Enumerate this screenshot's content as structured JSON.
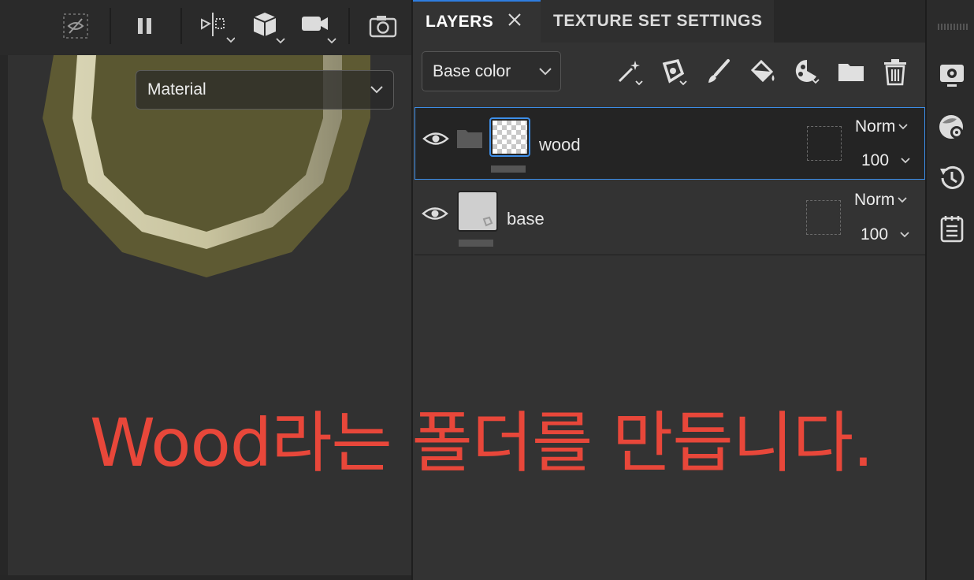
{
  "viewport": {
    "toolbar": {
      "icons": [
        "hide-icon",
        "pause-icon",
        "symmetry-icon",
        "cube-icon",
        "camera-video-icon",
        "screenshot-camera-icon"
      ]
    },
    "material_select": {
      "value": "Material"
    }
  },
  "caption": {
    "text": "Wood라는 폴더를 만듭니다."
  },
  "layers_panel": {
    "tabs": [
      {
        "label": "LAYERS",
        "active": true
      },
      {
        "label": "TEXTURE SET SETTINGS",
        "active": false
      }
    ],
    "channel_select": {
      "value": "Base color"
    },
    "tools": [
      "magic-wand-icon",
      "fill-layer-icon",
      "paint-brush-icon",
      "paint-bucket-icon",
      "generator-icon",
      "folder-icon",
      "trash-icon"
    ],
    "layers": [
      {
        "name": "wood",
        "blend": "Norm",
        "opacity": "100",
        "selected": true,
        "type": "folder"
      },
      {
        "name": "base",
        "blend": "Norm",
        "opacity": "100",
        "selected": false,
        "type": "fill"
      }
    ]
  },
  "dock": {
    "icons": [
      "settings-display-icon",
      "shader-settings-icon",
      "history-icon",
      "log-icon"
    ]
  },
  "colors": {
    "accent": "#3d8ee8",
    "caption": "#e8473a",
    "panel": "#333333"
  }
}
